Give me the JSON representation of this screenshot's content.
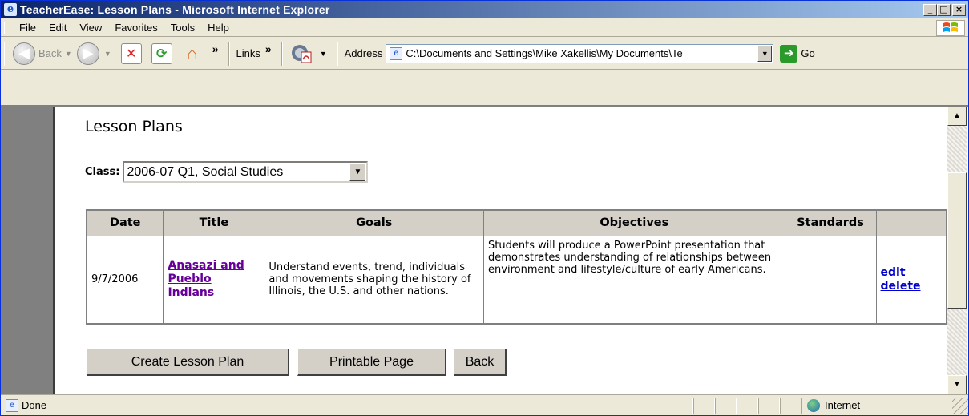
{
  "window": {
    "title": "TeacherEase: Lesson Plans - Microsoft Internet Explorer",
    "min_symbol": "_",
    "max_symbol": "□",
    "close_symbol": "×"
  },
  "menu": {
    "items": [
      "File",
      "Edit",
      "View",
      "Favorites",
      "Tools",
      "Help"
    ]
  },
  "toolbar": {
    "back_label": "Back",
    "links_label": "Links",
    "chevron": "»",
    "address_label": "Address",
    "address_value": "C:\\Documents and Settings\\Mike Xakellis\\My Documents\\Te",
    "go_label": "Go"
  },
  "page": {
    "title": "Lesson Plans",
    "class_label": "Class:",
    "class_selected": "2006-07 Q1, Social Studies",
    "table": {
      "headers": [
        "Date",
        "Title",
        "Goals",
        "Objectives",
        "Standards",
        ""
      ],
      "rows": [
        {
          "date": "9/7/2006",
          "title": "Anasazi and Pueblo Indians",
          "goals": "Understand events, trend, individuals and movements shaping the history of Illinois, the U.S. and other nations.",
          "objectives": "Students will produce a PowerPoint presentation that demonstrates understanding of relationships between environment and lifestyle/culture of early Americans.",
          "standards": "",
          "edit_label": "edit",
          "delete_label": "delete"
        }
      ]
    },
    "buttons": {
      "create": "Create Lesson Plan",
      "printable": "Printable Page",
      "back": "Back"
    }
  },
  "status": {
    "text": "Done",
    "zone": "Internet"
  },
  "icons": {
    "app": "ie-page-icon",
    "stop": "stop-icon",
    "refresh": "refresh-icon",
    "home": "home-icon",
    "pdf": "pdf-icon",
    "globe": "globe-icon"
  }
}
